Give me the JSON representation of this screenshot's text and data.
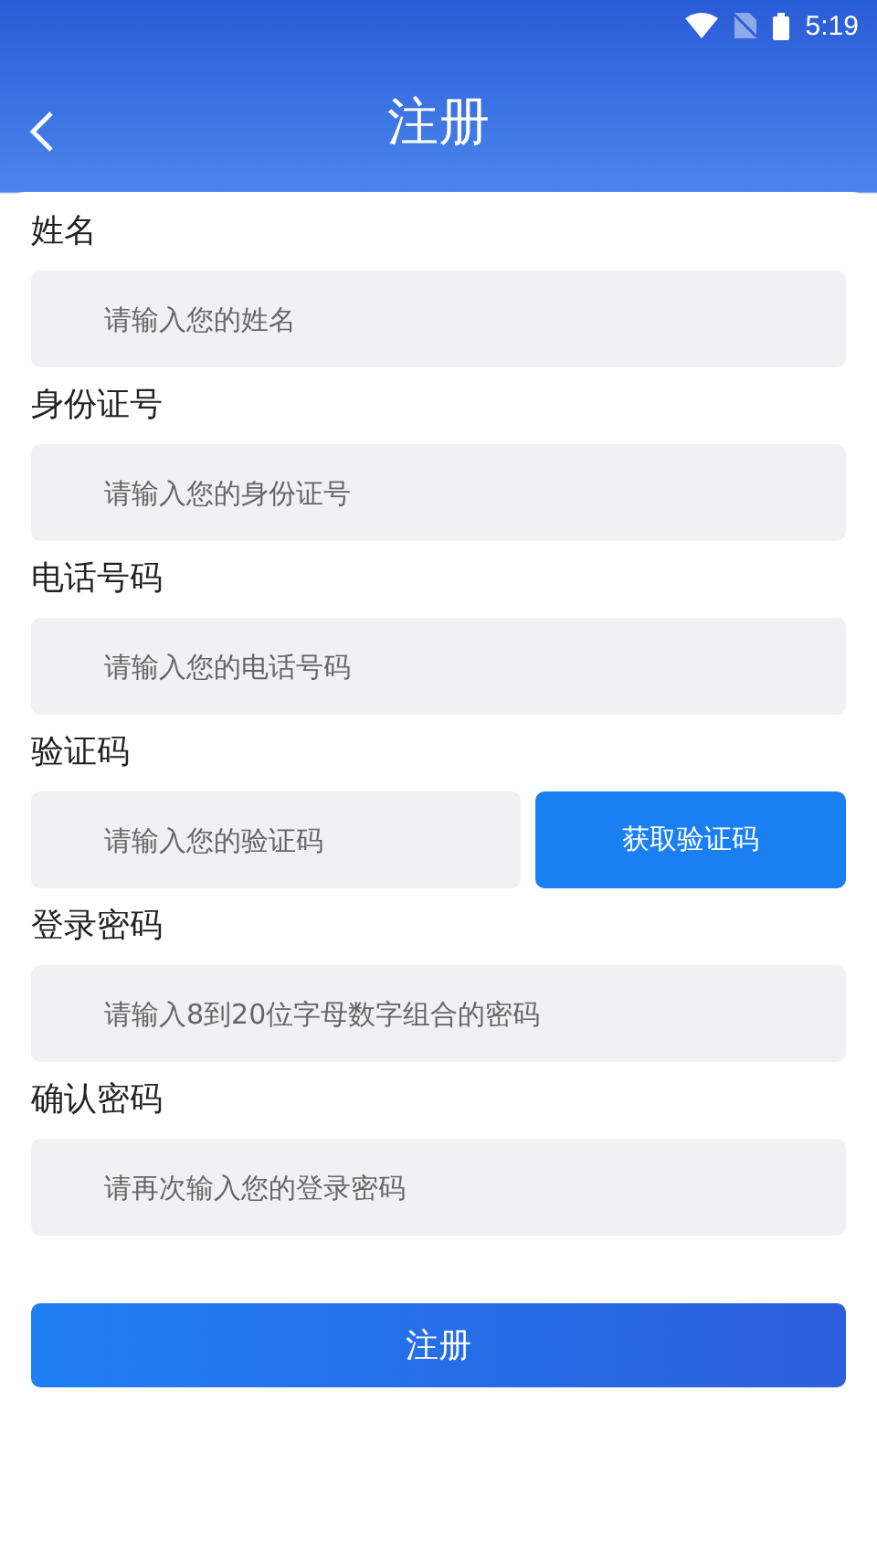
{
  "status_bar": {
    "time": "5:19"
  },
  "header": {
    "title": "注册"
  },
  "fields": [
    {
      "kind": "text",
      "label": "姓名",
      "placeholder": "请输入您的姓名"
    },
    {
      "kind": "text",
      "label": "身份证号",
      "placeholder": "请输入您的身份证号"
    },
    {
      "kind": "text",
      "label": "电话号码",
      "placeholder": "请输入您的电话号码"
    },
    {
      "kind": "code",
      "label": "验证码",
      "placeholder": "请输入您的验证码",
      "button": "获取验证码"
    },
    {
      "kind": "text",
      "label": "登录密码",
      "placeholder": "请输入8到20位字母数字组合的密码"
    },
    {
      "kind": "text",
      "label": "确认密码",
      "placeholder": "请再次输入您的登录密码"
    }
  ],
  "submit": "注册"
}
